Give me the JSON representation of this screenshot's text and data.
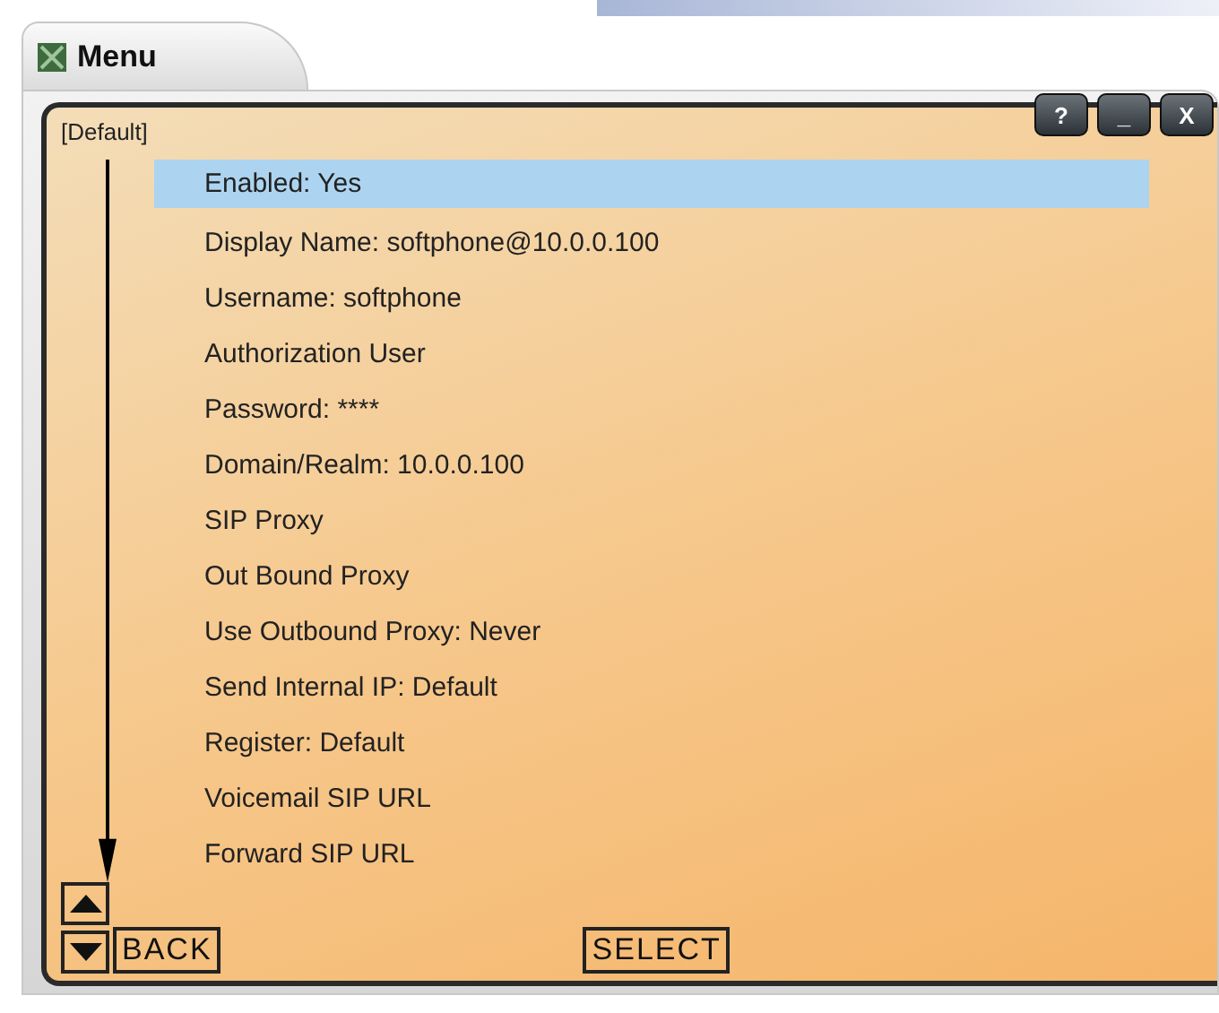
{
  "window": {
    "title": "Menu"
  },
  "profile": "[Default]",
  "title_buttons": [
    "?",
    "_",
    "X"
  ],
  "items": [
    {
      "label": "Enabled: Yes",
      "selected": true
    },
    {
      "label": "Display Name: softphone@10.0.0.100",
      "selected": false
    },
    {
      "label": "Username: softphone",
      "selected": false
    },
    {
      "label": "Authorization User",
      "selected": false
    },
    {
      "label": "Password: ****",
      "selected": false
    },
    {
      "label": "Domain/Realm: 10.0.0.100",
      "selected": false
    },
    {
      "label": "SIP Proxy",
      "selected": false
    },
    {
      "label": "Out Bound Proxy",
      "selected": false
    },
    {
      "label": "Use Outbound Proxy: Never",
      "selected": false
    },
    {
      "label": "Send Internal IP: Default",
      "selected": false
    },
    {
      "label": "Register: Default",
      "selected": false
    },
    {
      "label": "Voicemail SIP URL",
      "selected": false
    },
    {
      "label": "Forward SIP URL",
      "selected": false
    }
  ],
  "footer": {
    "back": "BACK",
    "select": "SELECT"
  }
}
